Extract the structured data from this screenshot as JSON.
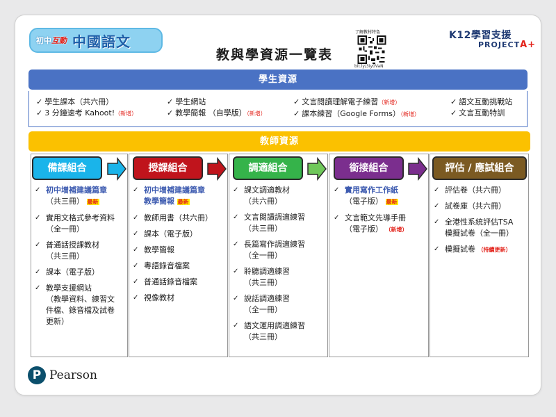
{
  "header": {
    "logo_small": "初中",
    "logo_small_accent": "互動",
    "logo_big": "中國語文",
    "title": "教與學資源一覽表",
    "qr_caption": "了解教材特色",
    "qr_url": "bit.ly/3iy0VaN",
    "k12": "K12學習支援",
    "project": "PROJECT",
    "project_plus": "A+"
  },
  "student": {
    "header": "學生資源",
    "columns": [
      [
        {
          "text": "學生課本（共六冊）",
          "tag": ""
        },
        {
          "text": "3 分鐘速考 Kahoot!",
          "tag": "（新增）"
        }
      ],
      [
        {
          "text": "學生網站",
          "tag": ""
        },
        {
          "text": "教學簡報 （自學版）",
          "tag": "（新增）"
        }
      ],
      [
        {
          "text": "文言閱讀理解電子練習",
          "tag": "（新增）"
        },
        {
          "text": "課本練習（Google Forms）",
          "tag": "（新增）"
        }
      ],
      [
        {
          "text": "語文互動挑戰站",
          "tag": ""
        },
        {
          "text": "文言互動特訓",
          "tag": ""
        }
      ]
    ]
  },
  "teacher": {
    "header": "教師資源",
    "categories": [
      {
        "label": "備課組合",
        "items": [
          {
            "lines": [
              "初中增補建議篇章",
              "（共三冊）"
            ],
            "tag": "最新",
            "tag_type": "latest",
            "highlight": true
          },
          {
            "lines": [
              "實用文格式參考資料",
              "（全一冊）"
            ],
            "tag": "",
            "tag_type": "",
            "highlight": false
          },
          {
            "lines": [
              "普通話授課教材",
              "（共三冊）"
            ],
            "tag": "",
            "tag_type": "",
            "highlight": false
          },
          {
            "lines": [
              "課本（電子版）"
            ],
            "tag": "",
            "tag_type": "",
            "highlight": false
          },
          {
            "lines": [
              "教學支援網站",
              "（教學資料、練習文",
              "件檔、錄音檔及試卷",
              "更新）"
            ],
            "tag": "",
            "tag_type": "",
            "highlight": false
          }
        ]
      },
      {
        "label": "授課組合",
        "items": [
          {
            "lines": [
              "初中增補建議篇章",
              "教學簡報"
            ],
            "tag": "最新",
            "tag_type": "latest",
            "highlight": true
          },
          {
            "lines": [
              "教師用書（共六冊）"
            ],
            "tag": "",
            "tag_type": "",
            "highlight": false
          },
          {
            "lines": [
              "課本（電子版）"
            ],
            "tag": "",
            "tag_type": "",
            "highlight": false
          },
          {
            "lines": [
              "教學簡報"
            ],
            "tag": "",
            "tag_type": "",
            "highlight": false
          },
          {
            "lines": [
              "粵語錄音檔案"
            ],
            "tag": "",
            "tag_type": "",
            "highlight": false
          },
          {
            "lines": [
              "普通話錄音檔案"
            ],
            "tag": "",
            "tag_type": "",
            "highlight": false
          },
          {
            "lines": [
              "視像教材"
            ],
            "tag": "",
            "tag_type": "",
            "highlight": false
          }
        ]
      },
      {
        "label": "調適組合",
        "items": [
          {
            "lines": [
              "課文調適教材",
              "（共六冊）"
            ],
            "tag": "",
            "tag_type": "",
            "highlight": false
          },
          {
            "lines": [
              "文言閱讀調適練習",
              "（共三冊）"
            ],
            "tag": "",
            "tag_type": "",
            "highlight": false
          },
          {
            "lines": [
              "長篇寫作調適練習",
              "（全一冊）"
            ],
            "tag": "",
            "tag_type": "",
            "highlight": false
          },
          {
            "lines": [
              "聆聽調適練習",
              "（共三冊）"
            ],
            "tag": "",
            "tag_type": "",
            "highlight": false
          },
          {
            "lines": [
              "說話調適練習",
              "（全一冊）"
            ],
            "tag": "",
            "tag_type": "",
            "highlight": false
          },
          {
            "lines": [
              "語文運用調適練習",
              "（共三冊）"
            ],
            "tag": "",
            "tag_type": "",
            "highlight": false
          }
        ]
      },
      {
        "label": "銜接組合",
        "items": [
          {
            "lines": [
              "實用寫作工作紙",
              "（電子版）"
            ],
            "tag": "最新",
            "tag_type": "latest",
            "highlight": true
          },
          {
            "lines": [
              "文言範文先導手冊",
              "（電子版）"
            ],
            "tag": "（新增）",
            "tag_type": "new",
            "highlight": false
          }
        ]
      },
      {
        "label": "評估 / 應試組合",
        "items": [
          {
            "lines": [
              "評估卷（共六冊）"
            ],
            "tag": "",
            "tag_type": "",
            "highlight": false
          },
          {
            "lines": [
              "試卷庫（共六冊）"
            ],
            "tag": "",
            "tag_type": "",
            "highlight": false
          },
          {
            "lines": [
              "全港性系統評估TSA",
              "模擬試卷（全一冊）"
            ],
            "tag": "",
            "tag_type": "",
            "highlight": false
          },
          {
            "lines": [
              "模擬試卷"
            ],
            "tag": "（持續更新）",
            "tag_type": "ongoing",
            "highlight": false
          }
        ]
      }
    ]
  },
  "footer": {
    "brand": "Pearson",
    "brand_initial": "P"
  },
  "colors": {
    "student_blue": "#4a72c4",
    "teacher_yellow": "#fbc100",
    "prep": "#1ab4ea",
    "teach": "#c0141c",
    "adapt": "#35b34a",
    "bridge": "#7b2e8e",
    "assess": "#7b5a22",
    "new_red": "#e3231b"
  }
}
